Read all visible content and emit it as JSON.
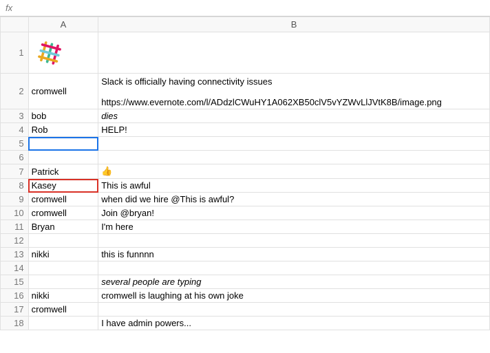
{
  "formula_bar": {
    "fx_label": "fx",
    "value": ""
  },
  "columns": {
    "a": "A",
    "b": "B"
  },
  "rows": [
    {
      "n": "1",
      "a": "",
      "b": "",
      "tall": true,
      "logo": true
    },
    {
      "n": "2",
      "a": "cromwell",
      "b": "Slack is officially having connectivity issues\n\nhttps://www.evernote.com/l/ADdzlCWuHY1A062XB50clV5vYZWvLlJVtK8B/image.png",
      "med": true
    },
    {
      "n": "3",
      "a": "bob",
      "b": "dies",
      "b_italic": true
    },
    {
      "n": "4",
      "a": "Rob",
      "b": "HELP!"
    },
    {
      "n": "5",
      "a": "",
      "b": "",
      "a_active": true
    },
    {
      "n": "6",
      "a": "",
      "b": ""
    },
    {
      "n": "7",
      "a": "Patrick",
      "b": "👍"
    },
    {
      "n": "8",
      "a": "Kasey",
      "b": "This is awful",
      "a_red": true
    },
    {
      "n": "9",
      "a": "cromwell",
      "b": "when did we hire @This is awful?"
    },
    {
      "n": "10",
      "a": "cromwell",
      "b": "Join @bryan!"
    },
    {
      "n": "11",
      "a": "Bryan",
      "b": "I'm here"
    },
    {
      "n": "12",
      "a": "",
      "b": ""
    },
    {
      "n": "13",
      "a": "nikki",
      "b": "this is funnnn"
    },
    {
      "n": "14",
      "a": "",
      "b": ""
    },
    {
      "n": "15",
      "a": "",
      "b": "several people are typing",
      "b_italic": true
    },
    {
      "n": "16",
      "a": "nikki",
      "b": "cromwell is laughing at his own joke"
    },
    {
      "n": "17",
      "a": "cromwell",
      "b": ""
    },
    {
      "n": "18",
      "a": "",
      "b": "I have admin powers..."
    }
  ]
}
